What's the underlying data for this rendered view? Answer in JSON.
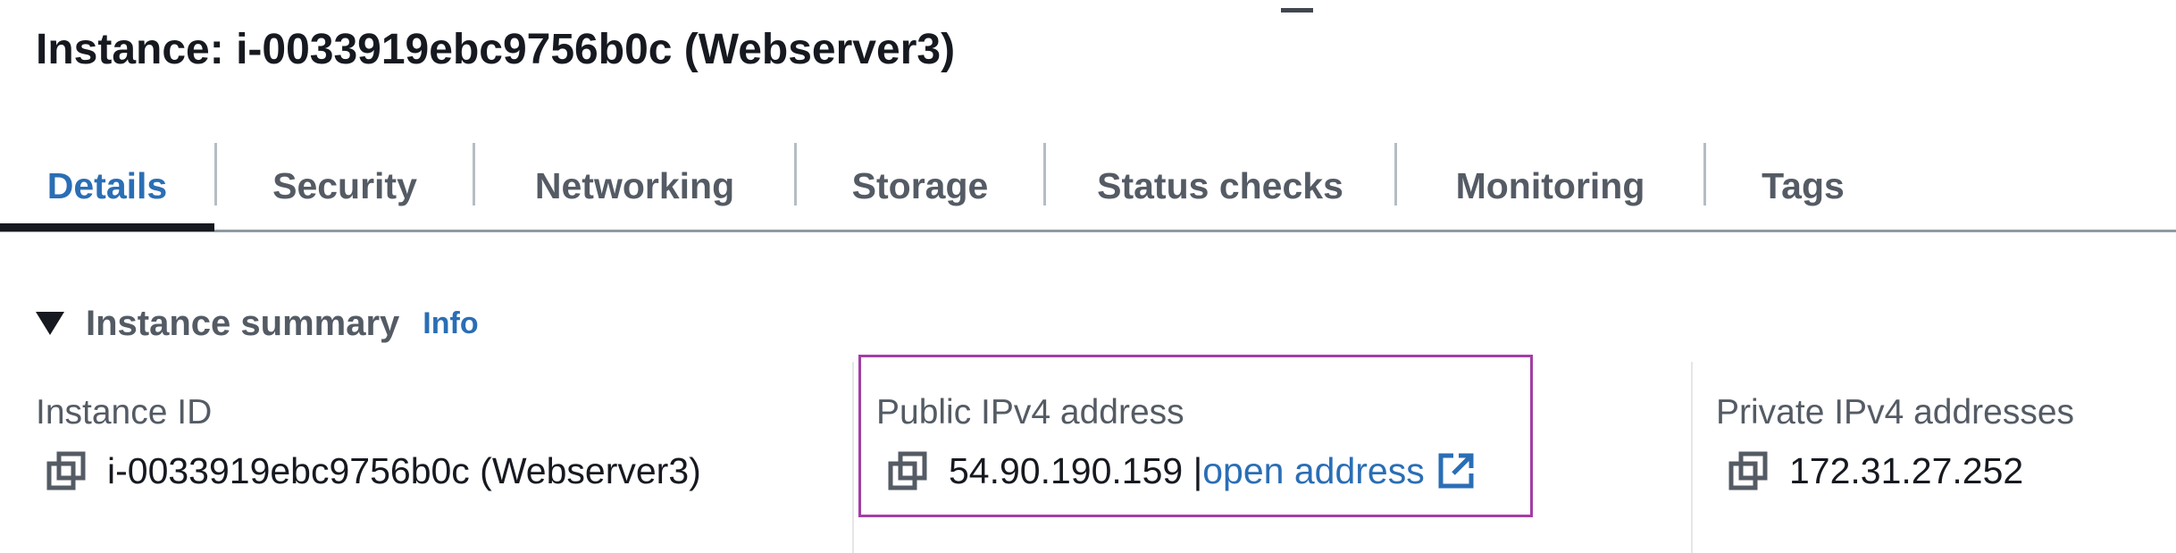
{
  "header": {
    "title": "Instance: i-0033919ebc9756b0c (Webserver3)"
  },
  "tabs": [
    {
      "label": "Details",
      "active": true
    },
    {
      "label": "Security",
      "active": false
    },
    {
      "label": "Networking",
      "active": false
    },
    {
      "label": "Storage",
      "active": false
    },
    {
      "label": "Status checks",
      "active": false
    },
    {
      "label": "Monitoring",
      "active": false
    },
    {
      "label": "Tags",
      "active": false
    }
  ],
  "summary": {
    "title": "Instance summary",
    "info_label": "Info",
    "fields": {
      "instance_id": {
        "label": "Instance ID",
        "value": "i-0033919ebc9756b0c (Webserver3)"
      },
      "public_ipv4": {
        "label": "Public IPv4 address",
        "value": "54.90.190.159 |",
        "link": "open address",
        "highlighted": true
      },
      "private_ipv4": {
        "label": "Private IPv4 addresses",
        "value": "172.31.27.252"
      }
    }
  },
  "icons": [
    "copy-icon",
    "external-link-icon",
    "caret-down-icon"
  ],
  "colors": {
    "accent": "#2a6eb5",
    "text": "#16191f",
    "muted": "#545b64",
    "highlight": "#a23ea5"
  }
}
